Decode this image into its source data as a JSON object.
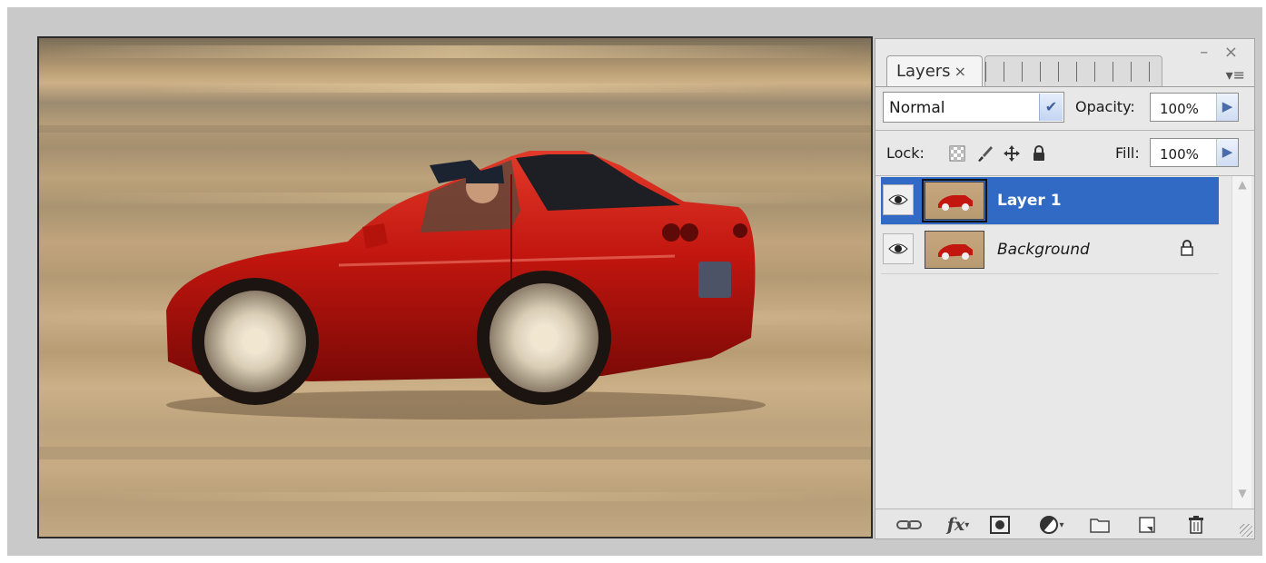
{
  "panel": {
    "tab_label": "Layers",
    "tab_close": "×",
    "window_controls": "– ×",
    "menu_glyph": "▾≡",
    "blend_mode": "Normal",
    "opacity_label": "Opacity:",
    "opacity_value": "100%",
    "lock_label": "Lock:",
    "fill_label": "Fill:",
    "fill_value": "100%",
    "layers": [
      {
        "name": "Layer 1",
        "selected": true,
        "visible": true,
        "locked": false
      },
      {
        "name": "Background",
        "selected": false,
        "visible": true,
        "locked": true
      }
    ],
    "bottom_icons": [
      "link-icon",
      "fx-icon",
      "mask-icon",
      "adjustment-icon",
      "folder-icon",
      "new-layer-icon",
      "trash-icon"
    ],
    "fx_text": "fx"
  },
  "canvas": {
    "subject": "red sports car with driver, motion blurred desert background",
    "colors": {
      "car_red": "#c2160f",
      "sand": "#c4a77f",
      "selection_blue": "#316ac5"
    }
  }
}
